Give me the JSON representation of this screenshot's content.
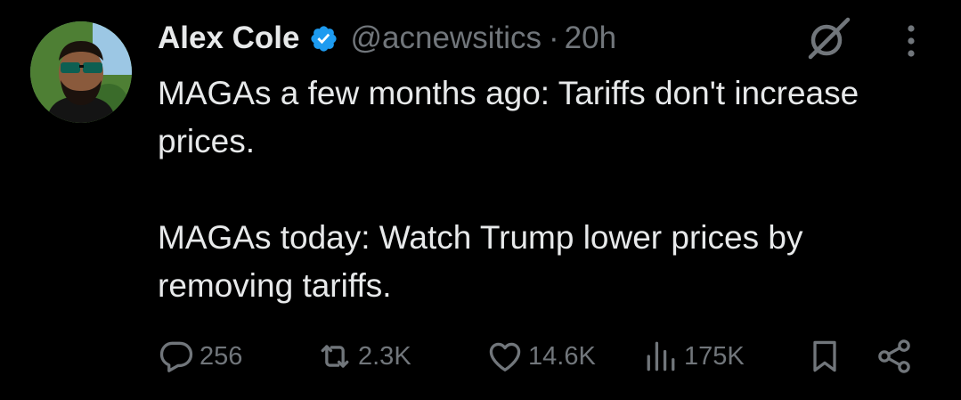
{
  "author": {
    "display_name": "Alex Cole",
    "handle": "@acnewsitics",
    "separator": "·",
    "time": "20h",
    "verified_icon": "verified-badge-icon",
    "verified_color": "#1d9bf0"
  },
  "tweet": {
    "lines": [
      "MAGAs a few months ago: Tariffs don't increase prices.",
      "MAGAs today: Watch Trump lower prices by removing tariffs."
    ]
  },
  "actions": {
    "replies": "256",
    "reposts": "2.3K",
    "likes": "14.6K",
    "views": "175K"
  },
  "icons": {
    "top_right": [
      "grok-icon",
      "more-options-icon"
    ],
    "action_bar": [
      "reply-icon",
      "repost-icon",
      "like-icon",
      "views-icon",
      "bookmark-icon",
      "share-icon"
    ]
  },
  "colors": {
    "background": "#000000",
    "primary_text": "#e7e9ea",
    "secondary_text": "#71767b"
  }
}
